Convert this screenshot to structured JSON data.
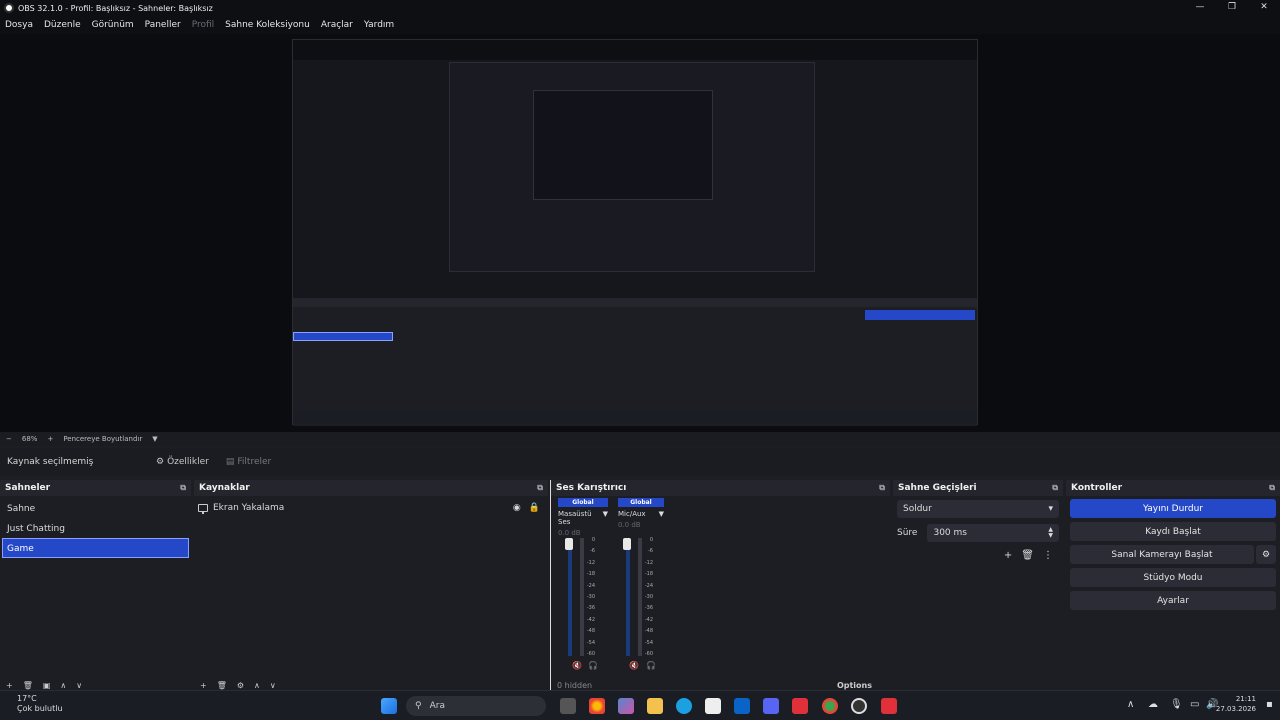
{
  "window": {
    "title": "OBS 32.1.0 - Profil: Başlıksız - Sahneler: Başlıksız"
  },
  "menu": [
    "Dosya",
    "Düzenle",
    "Görünüm",
    "Paneller",
    "Profil",
    "Sahne Koleksiyonu",
    "Araçlar",
    "Yardım"
  ],
  "status": {
    "minus": "−",
    "zoom": "68%",
    "plus": "+",
    "resize": "Pencereye Boyutlandır"
  },
  "props": {
    "no_source": "Kaynak seçilmemiş",
    "properties": "Özellikler",
    "filters": "Filtreler"
  },
  "scenes": {
    "title": "Sahneler",
    "items": [
      "Sahne",
      "Just Chatting",
      "Game"
    ]
  },
  "sources": {
    "title": "Kaynaklar",
    "items": [
      {
        "label": "Ekran Yakalama"
      }
    ]
  },
  "mixer": {
    "title": "Ses Karıştırıcı",
    "channels": [
      {
        "badge": "Global",
        "name": "Masaüstü Ses",
        "db": "0.0 dB"
      },
      {
        "badge": "Global",
        "name": "Mic/Aux",
        "db": "0.0 dB"
      }
    ],
    "ticks": [
      "0",
      "-6",
      "-12",
      "-18",
      "-24",
      "-30",
      "-36",
      "-42",
      "-48",
      "-54",
      "-60"
    ],
    "hidden": "0 hidden",
    "options": "Options"
  },
  "transitions": {
    "title": "Sahne Geçişleri",
    "selected": "Soldur",
    "duration_label": "Süre",
    "duration_value": "300 ms"
  },
  "controls": {
    "title": "Kontroller",
    "buttons": [
      "Yayını Durdur",
      "Kaydı Başlat",
      "Sanal Kamerayı Başlat",
      "Stüdyo Modu",
      "Ayarlar"
    ]
  },
  "taskbar": {
    "temp": "17°C",
    "weather": "Çok bulutlu",
    "search": "Ara",
    "time": "21:11",
    "date": "27.03.2026"
  },
  "colors": {
    "accent": "#2548c8",
    "background": "#1d1e24",
    "panel_header": "#25262d"
  }
}
